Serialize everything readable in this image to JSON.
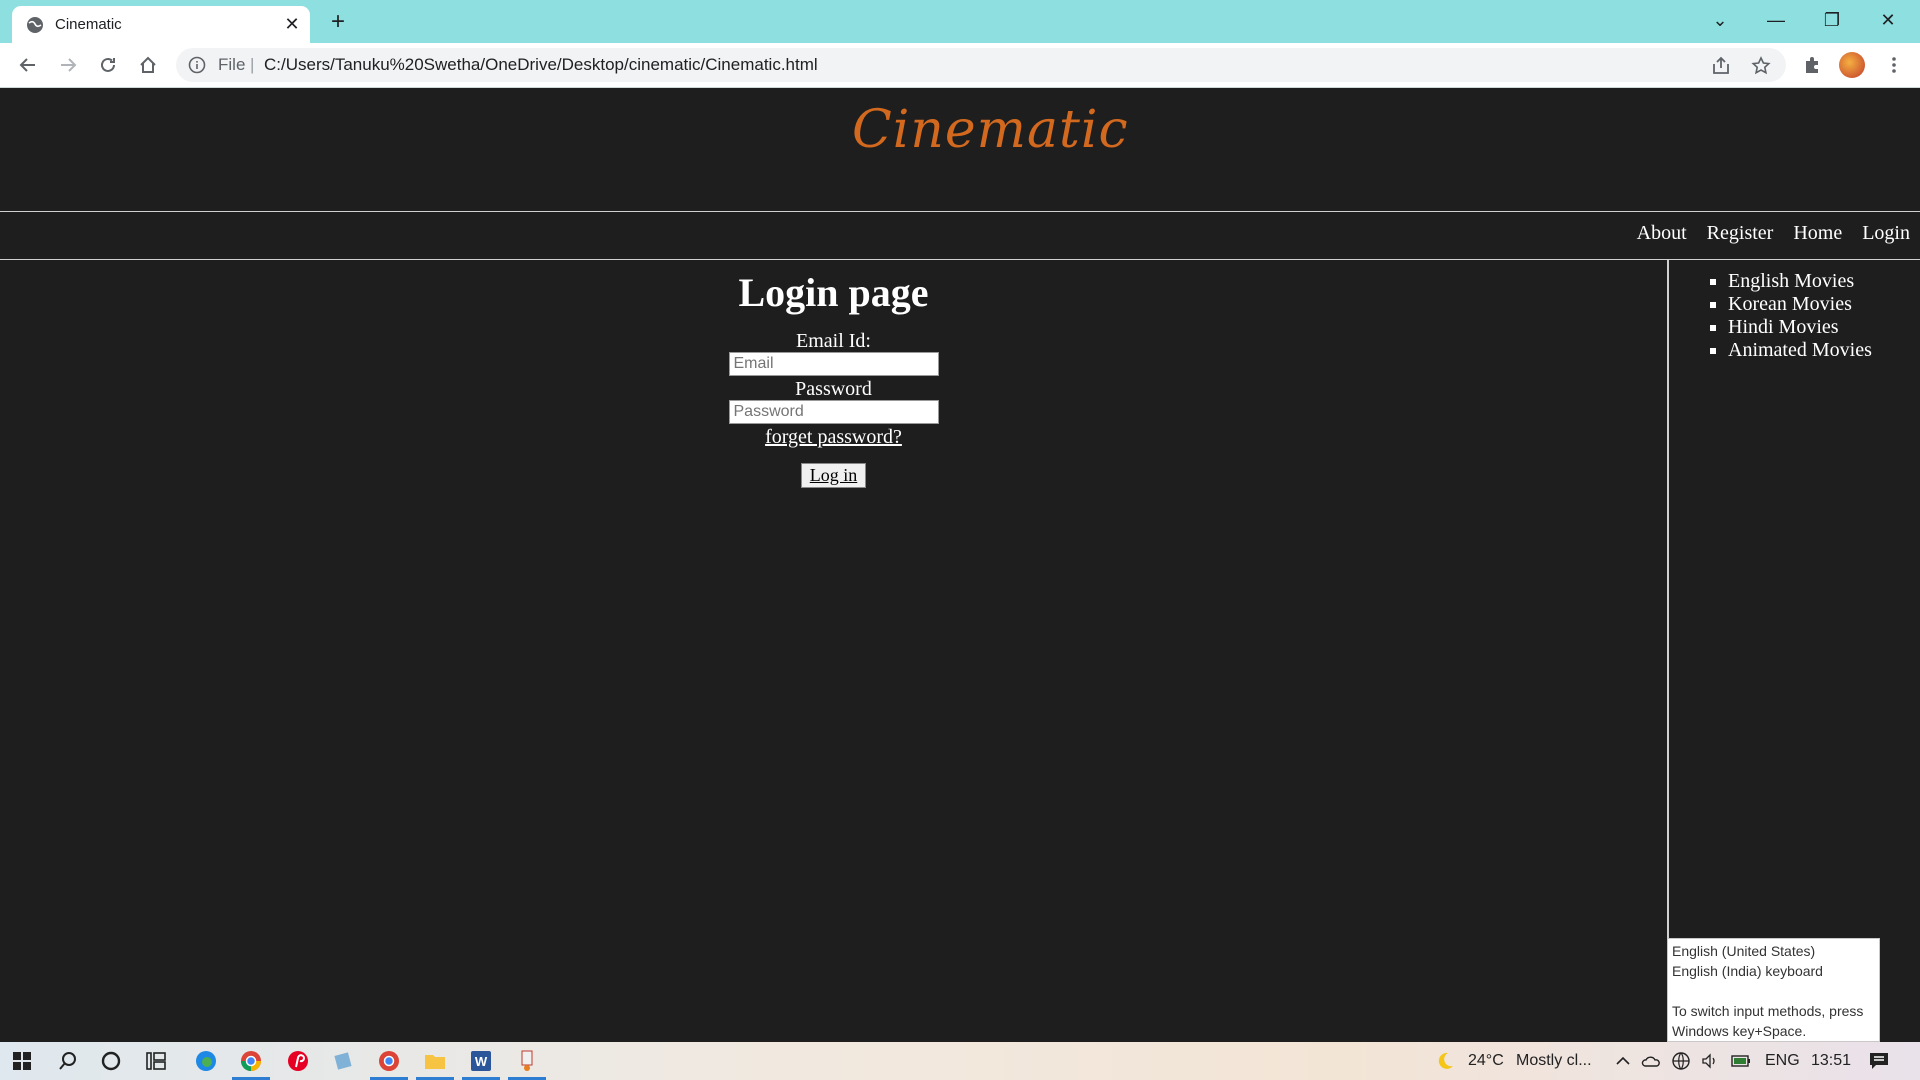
{
  "browser": {
    "tab_title": "Cinematic",
    "omnibox_scheme": "File",
    "omnibox_separator": "|",
    "url": "C:/Users/Tanuku%20Swetha/OneDrive/Desktop/cinematic/Cinematic.html"
  },
  "site": {
    "logo": "Cinematic",
    "nav": [
      "About",
      "Register",
      "Home",
      "Login"
    ],
    "sidebar_links": [
      "English Movies",
      "Korean Movies",
      "Hindi Movies",
      "Animated Movies"
    ],
    "heading": "Login page",
    "email_label": "Email Id:",
    "email_placeholder": "Email",
    "password_label": "Password",
    "password_placeholder": "Password",
    "forgot_link": "forget password?",
    "login_button": "Log in"
  },
  "tooltip": {
    "line1": "English (United States)",
    "line2": "English (India) keyboard",
    "line3": "To switch input methods, press Windows key+Space."
  },
  "taskbar": {
    "weather_temp": "24°C",
    "weather_desc": "Mostly cl...",
    "language": "ENG",
    "time": "13:51"
  }
}
